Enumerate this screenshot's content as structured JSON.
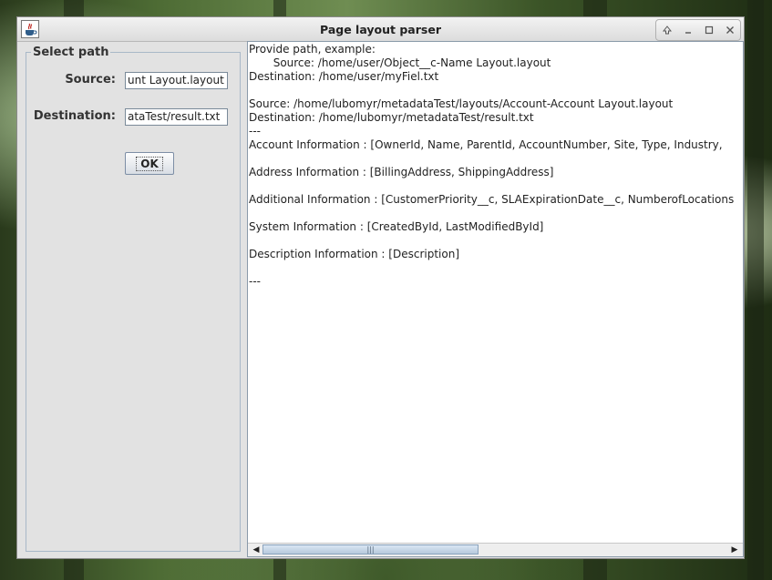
{
  "window": {
    "title": "Page layout parser"
  },
  "form": {
    "legend": "Select path",
    "source_label": "Source:",
    "source_value": "unt Layout.layout",
    "destination_label": "Destination:",
    "destination_value": "ataTest/result.txt",
    "ok_label": "OK"
  },
  "output": {
    "lines": [
      "Provide path, example:",
      "       Source: /home/user/Object__c-Name Layout.layout",
      "Destination: /home/user/myFiel.txt",
      "",
      "Source: /home/lubomyr/metadataTest/layouts/Account-Account Layout.layout",
      "Destination: /home/lubomyr/metadataTest/result.txt",
      "---",
      "Account Information : [OwnerId, Name, ParentId, AccountNumber, Site, Type, Industry,",
      "",
      "Address Information : [BillingAddress, ShippingAddress]",
      "",
      "Additional Information : [CustomerPriority__c, SLAExpirationDate__c, NumberofLocations",
      "",
      "System Information : [CreatedById, LastModifiedById]",
      "",
      "Description Information : [Description]",
      "",
      "---"
    ]
  },
  "icons": {
    "app": "java-cup-icon",
    "wm": [
      "keep-above-icon",
      "minimize-icon",
      "maximize-icon",
      "close-icon"
    ]
  }
}
